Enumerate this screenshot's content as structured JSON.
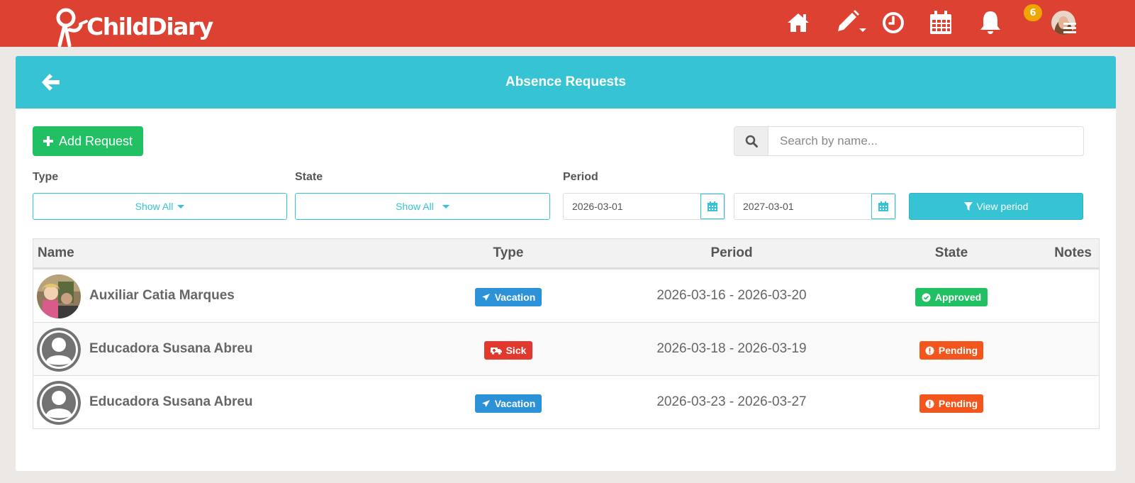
{
  "app": {
    "logo_text": "ChildDiary",
    "notification_count": "6"
  },
  "nav": {
    "icons": [
      "home-icon",
      "pencil-icon",
      "clock-icon",
      "calendar-icon",
      "bell-icon",
      "user-avatar"
    ]
  },
  "page": {
    "title": "Absence Requests"
  },
  "toolbar": {
    "add_label": "Add Request",
    "search_placeholder": "Search by name..."
  },
  "filters": {
    "type_label": "Type",
    "type_value": "Show All",
    "state_label": "State",
    "state_value": "Show All",
    "period_label": "Period",
    "start_date": "2026-03-01",
    "end_date": "2027-03-01",
    "view_label": "View period"
  },
  "table": {
    "headers": {
      "name": "Name",
      "type": "Type",
      "period": "Period",
      "state": "State",
      "notes": "Notes"
    },
    "rows": [
      {
        "name": "Auxiliar Catia Marques",
        "type": "Vacation",
        "period": "2026-03-16 - 2026-03-20",
        "state": "Approved",
        "notes": ""
      },
      {
        "name": "Educadora Susana Abreu",
        "type": "Sick",
        "period": "2026-03-18 - 2026-03-19",
        "state": "Pending",
        "notes": ""
      },
      {
        "name": "Educadora Susana Abreu",
        "type": "Vacation",
        "period": "2026-03-23 - 2026-03-27",
        "state": "Pending",
        "notes": ""
      }
    ]
  },
  "colors": {
    "topbar": "#dc4132",
    "header": "#36c4d4",
    "success": "#21c063",
    "vacation": "#2c92d8",
    "sick": "#e1392d",
    "pending": "#f2561d",
    "badge": "#f0a500"
  }
}
